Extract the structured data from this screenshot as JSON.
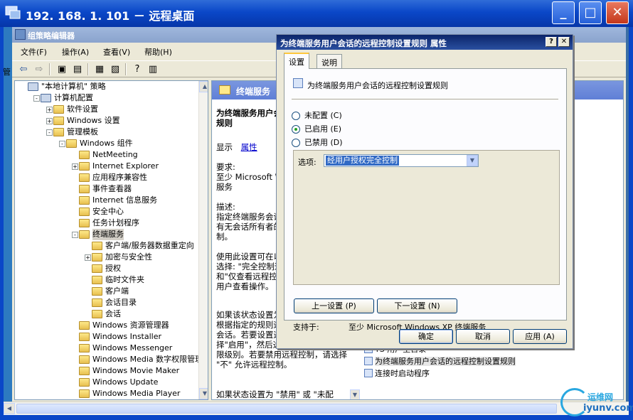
{
  "remote_desktop": {
    "title": "192. 168. 1. 101 － 远程桌面",
    "minimize": "_",
    "maximize": "□",
    "close": "✕"
  },
  "gpedit": {
    "title": "组策略编辑器",
    "menu": [
      "文件(F)",
      "操作(A)",
      "查看(V)",
      "帮助(H)"
    ],
    "left_edge_char": "管",
    "tree": [
      {
        "label": "\"本地计算机\" 策略",
        "level": 0,
        "exp": ""
      },
      {
        "label": "计算机配置",
        "level": 1,
        "exp": "-"
      },
      {
        "label": "软件设置",
        "level": 2,
        "exp": "+"
      },
      {
        "label": "Windows 设置",
        "level": 2,
        "exp": "+"
      },
      {
        "label": "管理模板",
        "level": 2,
        "exp": "-"
      },
      {
        "label": "Windows 组件",
        "level": 3,
        "exp": "-"
      },
      {
        "label": "NetMeeting",
        "level": 4,
        "exp": ""
      },
      {
        "label": "Internet Explorer",
        "level": 4,
        "exp": "+"
      },
      {
        "label": "应用程序兼容性",
        "level": 4,
        "exp": ""
      },
      {
        "label": "事件查看器",
        "level": 4,
        "exp": ""
      },
      {
        "label": "Internet 信息服务",
        "level": 4,
        "exp": ""
      },
      {
        "label": "安全中心",
        "level": 4,
        "exp": ""
      },
      {
        "label": "任务计划程序",
        "level": 4,
        "exp": ""
      },
      {
        "label": "终端服务",
        "level": 4,
        "exp": "-"
      },
      {
        "label": "客户端/服务器数据重定向",
        "level": 5,
        "exp": ""
      },
      {
        "label": "加密与安全性",
        "level": 5,
        "exp": "+"
      },
      {
        "label": "授权",
        "level": 5,
        "exp": ""
      },
      {
        "label": "临时文件夹",
        "level": 5,
        "exp": ""
      },
      {
        "label": "客户端",
        "level": 5,
        "exp": ""
      },
      {
        "label": "会话目录",
        "level": 5,
        "exp": ""
      },
      {
        "label": "会话",
        "level": 5,
        "exp": ""
      },
      {
        "label": "Windows 资源管理器",
        "level": 4,
        "exp": ""
      },
      {
        "label": "Windows Installer",
        "level": 4,
        "exp": ""
      },
      {
        "label": "Windows Messenger",
        "level": 4,
        "exp": ""
      },
      {
        "label": "Windows Media 数字权限管理",
        "level": 4,
        "exp": ""
      },
      {
        "label": "Windows Movie Maker",
        "level": 4,
        "exp": ""
      },
      {
        "label": "Windows Update",
        "level": 4,
        "exp": ""
      },
      {
        "label": "Windows Media Player",
        "level": 4,
        "exp": ""
      }
    ],
    "right_header": "终端服务",
    "desc": {
      "title": "为终端服务用户会话的远程控制设置规则",
      "show": "显示",
      "properties_link": "属性",
      "req_label": "要求:",
      "req_text": "至少 Microsoft Windows XP 终端服务",
      "desc_label": "描述:",
      "desc_text": "指定终端服务会话的远程控制级别。有无会话所有者的许可下建立远程控制。",
      "p1": "使用此设置可在以下两种级别中进行选择: \"完全控制远程控制用户查看和\"仅查看远程控制\" 允许远程控制用户查看操作。",
      "p2": "如果该状态设置为\"启用\"，管理员可根据指定的规则远程控制的终端服务会话。若要设置这些规则，请选择\"启用\"，然后选择需要的控制和权限级别。若要禁用远程控制，请选择 \"不\" 允许远程控制。",
      "p3": "如果状态设置为 \"禁用\" 或 \"未配"
    },
    "list": [
      {
        "label": "TS 用户主目录",
        "selected": false
      },
      {
        "label": "为终端服务用户会话的远程控制设置规则",
        "selected": true
      },
      {
        "label": "连接时启动程序",
        "selected": false
      }
    ]
  },
  "dialog": {
    "title": "为终端服务用户会话的远程控制设置规则 属性",
    "help": "?",
    "close": "✕",
    "tabs": [
      "设置",
      "说明"
    ],
    "policy_name": "为终端服务用户会话的远程控制设置规则",
    "radios": [
      {
        "label": "未配置 (C)",
        "checked": false
      },
      {
        "label": "已启用 (E)",
        "checked": true
      },
      {
        "label": "已禁用 (D)",
        "checked": false
      }
    ],
    "options_label": "选项:",
    "options_value": "经用户授权完全控制",
    "supported_label": "支持于:",
    "supported_value": "至少 Microsoft Windows XP 终端服务",
    "prev_button": "上一设置 (P)",
    "next_button": "下一设置 (N)",
    "ok_button": "确定",
    "cancel_button": "取消",
    "apply_button": "应用 (A)"
  },
  "watermark": {
    "line1": "运维网",
    "line2": "iyunv.com"
  }
}
